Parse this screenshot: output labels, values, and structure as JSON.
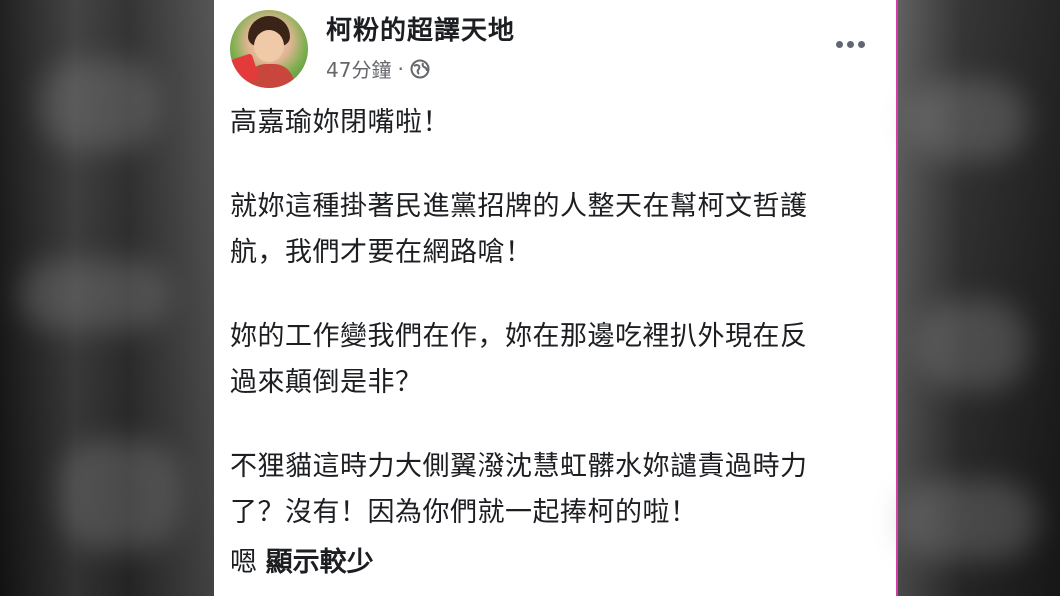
{
  "post": {
    "page_name": "柯粉的超譯天地",
    "timestamp": "47分鐘",
    "separator": "·",
    "privacy_icon": "globe-icon",
    "more_icon": "more-horizontal-icon",
    "paragraphs": [
      [
        "高嘉瑜妳閉嘴啦！"
      ],
      [
        "就妳這種掛著民進黨招牌的人整天在幫柯文哲護",
        "航，我們才要在網路嗆！"
      ],
      [
        "妳的工作變我們在作，妳在那邊吃裡扒外現在反",
        "過來顛倒是非？"
      ],
      [
        "不狸貓這時力大側翼潑沈慧虹髒水妳譴責過時力",
        "了？沒有！因為你們就一起捧柯的啦！"
      ]
    ],
    "trailing_text": "嗯",
    "see_more_label": "顯示較少"
  },
  "colors": {
    "name_text": "#1c1e21",
    "meta_text": "#65676b",
    "accent_divider": "#d63aa6"
  }
}
